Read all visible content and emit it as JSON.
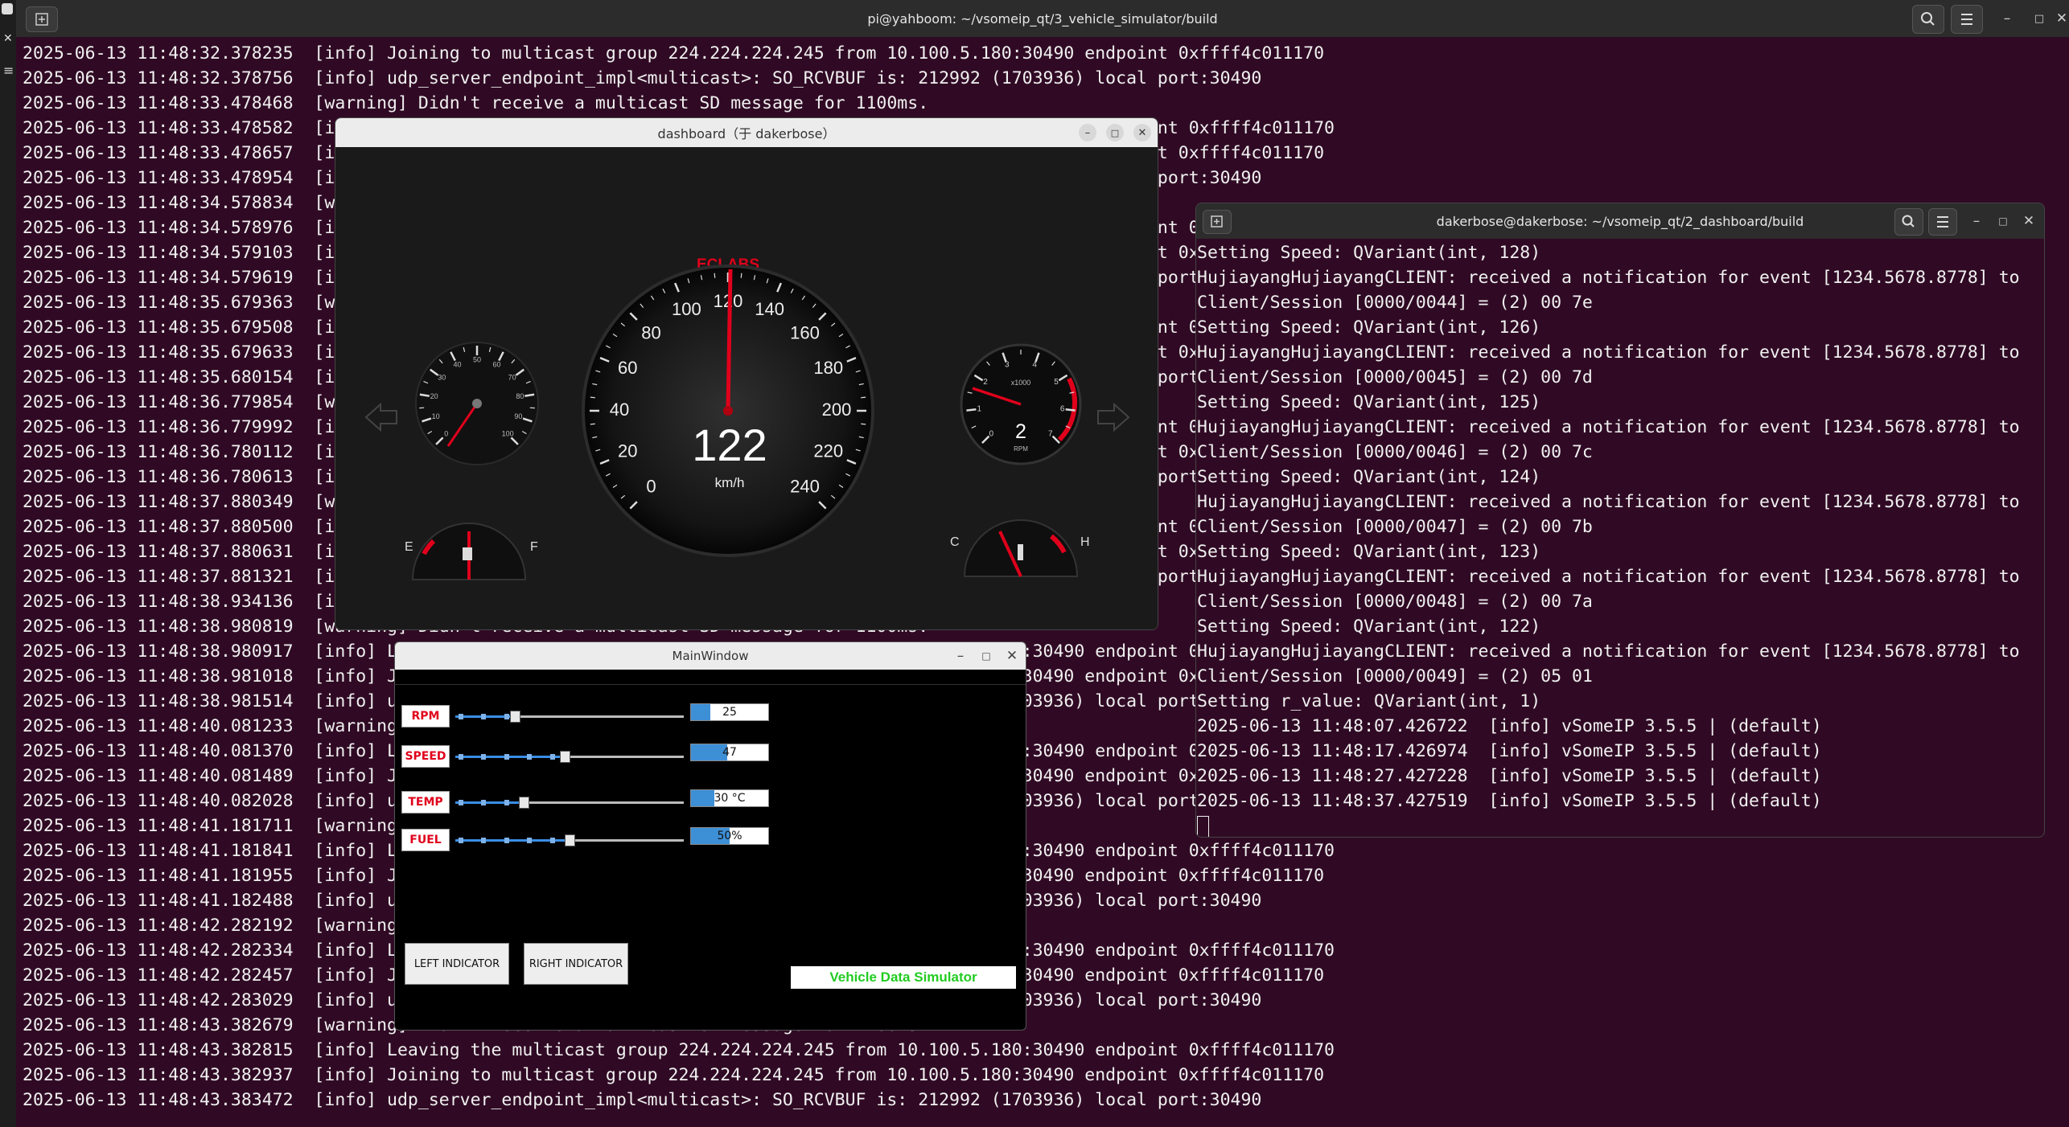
{
  "bg_terminal": {
    "title": "pi@yahboom: ~/vsomeip_qt/3_vehicle_simulator/build",
    "lines": [
      "2025-06-13 11:48:32.378235  [info] Joining to multicast group 224.224.224.245 from 10.100.5.180:30490 endpoint 0xffff4c011170",
      "2025-06-13 11:48:32.378756  [info] udp_server_endpoint_impl<multicast>: SO_RCVBUF is: 212992 (1703936) local port:30490",
      "2025-06-13 11:48:33.478468  [warning] Didn't receive a multicast SD message for 1100ms.",
      "2025-06-13 11:48:33.478582  [info] Leaving the multicast group 224.224.224.245 from 10.100.5.180:30490 endpoint 0xffff4c011170",
      "2025-06-13 11:48:33.478657  [info] Joining to multicast group 224.224.224.245 from 10.100.5.180:30490 endpoint 0xffff4c011170",
      "2025-06-13 11:48:33.478954  [info] udp_server_endpoint_impl<multicast>: SO_RCVBUF is: 212992 (1703936) local port:30490",
      "2025-06-13 11:48:34.578834  [warning] Didn't receive a multicast SD message for 1100ms.",
      "2025-06-13 11:48:34.578976  [info] Leaving the multicast group 224.224.224.245 from 10.100.5.180:30490 endpoint 0xffff4c011170",
      "2025-06-13 11:48:34.579103  [info] Joining to multicast group 224.224.224.245 from 10.100.5.180:30490 endpoint 0xffff4c011170",
      "2025-06-13 11:48:34.579619  [info] udp_server_endpoint_impl<multicast>: SO_RCVBUF is: 212992 (1703936) local port:30490",
      "2025-06-13 11:48:35.679363  [warning] Didn't receive a multicast SD message for 1100ms.",
      "2025-06-13 11:48:35.679508  [info] Leaving the multicast group 224.224.224.245 from 10.100.5.180:30490 endpoint 0xffff4c011170",
      "2025-06-13 11:48:35.679633  [info] Joining to multicast group 224.224.224.245 from 10.100.5.180:30490 endpoint 0xffff4c011170",
      "2025-06-13 11:48:35.680154  [info] udp_server_endpoint_impl<multicast>: SO_RCVBUF is: 212992 (1703936) local port:30490",
      "2025-06-13 11:48:36.779854  [warning] Didn't receive a multicast SD message for 1100ms.",
      "2025-06-13 11:48:36.779992  [info] Leaving the multicast group 224.224.224.245 from 10.100.5.180:30490 endpoint 0xffff4c011170",
      "2025-06-13 11:48:36.780112  [info] Joining to multicast group 224.224.224.245 from 10.100.5.180:30490 endpoint 0xffff4c011170",
      "2025-06-13 11:48:36.780613  [info] udp_server_endpoint_impl<multicast>: SO_RCVBUF is: 212992 (1703936) local port:30490",
      "2025-06-13 11:48:37.880349  [warning] Didn't receive a multicast SD message for 1100ms.",
      "2025-06-13 11:48:37.880500  [info] Leaving the multicast group 224.224.224.245 from 10.100.5.180:30490 endpoint 0xffff4c011170",
      "2025-06-13 11:48:37.880631  [info] Joining to multicast group 224.224.224.245 from 10.100.5.180:30490 endpoint 0xffff4c011170",
      "2025-06-13 11:48:37.881321  [info] udp_server_endpoint_impl<multicast>: SO_RCVBUF is: 212992 (1703936) local port:30490",
      "2025-06-13 11:48:38.934136  [info] vSomeIP 3.5.5 | (default)",
      "2025-06-13 11:48:38.980819  [warning] Didn't receive a multicast SD message for 1100ms.",
      "2025-06-13 11:48:38.980917  [info] Leaving the multicast group 224.224.224.245 from 10.100.5.180:30490 endpoint 0xffff4c011170",
      "2025-06-13 11:48:38.981018  [info] Joining to multicast group 224.224.224.245 from 10.100.5.180:30490 endpoint 0xffff4c011170",
      "2025-06-13 11:48:38.981514  [info] udp_server_endpoint_impl<multicast>: SO_RCVBUF is: 212992 (1703936) local port:30490",
      "2025-06-13 11:48:40.081233  [warning] Didn't receive a multicast SD message for 1100ms.",
      "2025-06-13 11:48:40.081370  [info] Leaving the multicast group 224.224.224.245 from 10.100.5.180:30490 endpoint 0xffff4c011170",
      "2025-06-13 11:48:40.081489  [info] Joining to multicast group 224.224.224.245 from 10.100.5.180:30490 endpoint 0xffff4c011170",
      "2025-06-13 11:48:40.082028  [info] udp_server_endpoint_impl<multicast>: SO_RCVBUF is: 212992 (1703936) local port:30490",
      "2025-06-13 11:48:41.181711  [warning] Didn't receive a multicast SD message for 1100ms.",
      "2025-06-13 11:48:41.181841  [info] Leaving the multicast group 224.224.224.245 from 10.100.5.180:30490 endpoint 0xffff4c011170",
      "2025-06-13 11:48:41.181955  [info] Joining to multicast group 224.224.224.245 from 10.100.5.180:30490 endpoint 0xffff4c011170",
      "2025-06-13 11:48:41.182488  [info] udp_server_endpoint_impl<multicast>: SO_RCVBUF is: 212992 (1703936) local port:30490",
      "2025-06-13 11:48:42.282192  [warning] Didn't receive a multicast SD message for 1100ms.",
      "2025-06-13 11:48:42.282334  [info] Leaving the multicast group 224.224.224.245 from 10.100.5.180:30490 endpoint 0xffff4c011170",
      "2025-06-13 11:48:42.282457  [info] Joining to multicast group 224.224.224.245 from 10.100.5.180:30490 endpoint 0xffff4c011170",
      "2025-06-13 11:48:42.283029  [info] udp_server_endpoint_impl<multicast>: SO_RCVBUF is: 212992 (1703936) local port:30490",
      "2025-06-13 11:48:43.382679  [warning] Didn't receive a multicast SD message for 1100ms.",
      "2025-06-13 11:48:43.382815  [info] Leaving the multicast group 224.224.224.245 from 10.100.5.180:30490 endpoint 0xffff4c011170",
      "2025-06-13 11:48:43.382937  [info] Joining to multicast group 224.224.224.245 from 10.100.5.180:30490 endpoint 0xffff4c011170",
      "2025-06-13 11:48:43.383472  [info] udp_server_endpoint_impl<multicast>: SO_RCVBUF is: 212992 (1703936) local port:30490"
    ]
  },
  "right_terminal": {
    "title": "dakerbose@dakerbose: ~/vsomeip_qt/2_dashboard/build",
    "lines": [
      "Setting Speed: QVariant(int, 128)",
      "HujiayangHujiayangCLIENT: received a notification for event [1234.5678.8778] to",
      "Client/Session [0000/0044] = (2) 00 7e",
      "Setting Speed: QVariant(int, 126)",
      "HujiayangHujiayangCLIENT: received a notification for event [1234.5678.8778] to",
      "Client/Session [0000/0045] = (2) 00 7d",
      "Setting Speed: QVariant(int, 125)",
      "HujiayangHujiayangCLIENT: received a notification for event [1234.5678.8778] to",
      "Client/Session [0000/0046] = (2) 00 7c",
      "Setting Speed: QVariant(int, 124)",
      "HujiayangHujiayangCLIENT: received a notification for event [1234.5678.8778] to",
      "Client/Session [0000/0047] = (2) 00 7b",
      "Setting Speed: QVariant(int, 123)",
      "HujiayangHujiayangCLIENT: received a notification for event [1234.5678.8778] to",
      "Client/Session [0000/0048] = (2) 00 7a",
      "Setting Speed: QVariant(int, 122)",
      "HujiayangHujiayangCLIENT: received a notification for event [1234.5678.8778] to",
      "Client/Session [0000/0049] = (2) 05 01",
      "Setting r_value: QVariant(int, 1)",
      "2025-06-13 11:48:07.426722  [info] vSomeIP 3.5.5 | (default)",
      "2025-06-13 11:48:17.426974  [info] vSomeIP 3.5.5 | (default)",
      "2025-06-13 11:48:27.427228  [info] vSomeIP 3.5.5 | (default)",
      "2025-06-13 11:48:37.427519  [info] vSomeIP 3.5.5 | (default)"
    ]
  },
  "dashboard": {
    "title": "dashboard（于 dakerbose）",
    "brand": "ECLABS",
    "speed_value": "122",
    "speed_unit": "km/h",
    "speed_ticks": [
      "0",
      "20",
      "40",
      "60",
      "80",
      "100",
      "120",
      "140",
      "160",
      "180",
      "200",
      "220",
      "240"
    ],
    "small_gauge_ticks": [
      "0",
      "10",
      "20",
      "30",
      "40",
      "50",
      "60",
      "70",
      "80",
      "90",
      "100"
    ],
    "rpm_ticks": [
      "0",
      "1",
      "2",
      "3",
      "4",
      "5",
      "6",
      "7"
    ],
    "rpm_multiplier": "x1000",
    "rpm_value": "2",
    "rpm_unit": "RPM",
    "fuel_empty": "E",
    "fuel_full": "F",
    "temp_cold": "C",
    "temp_hot": "H"
  },
  "mainwindow": {
    "title": "MainWindow",
    "rows": [
      {
        "label": "RPM",
        "fraction": 0.26,
        "bar_text": "25",
        "bar_fraction": 0.25
      },
      {
        "label": "SPEED",
        "fraction": 0.48,
        "bar_text": "47",
        "bar_fraction": 0.47
      },
      {
        "label": "TEMP",
        "fraction": 0.3,
        "bar_text": "30 °C",
        "bar_fraction": 0.3
      },
      {
        "label": "FUEL",
        "fraction": 0.5,
        "bar_text": "50%",
        "bar_fraction": 0.5
      }
    ],
    "left_indicator": "LEFT INDICATOR",
    "right_indicator": "RIGHT INDICATOR",
    "simulator_label": "Vehicle Data Simulator"
  },
  "colors": {
    "terminal_bg": "#300a24",
    "accent_red": "#e0001b",
    "progress_blue": "#3d8fd6",
    "simulator_green": "#22cc22"
  }
}
